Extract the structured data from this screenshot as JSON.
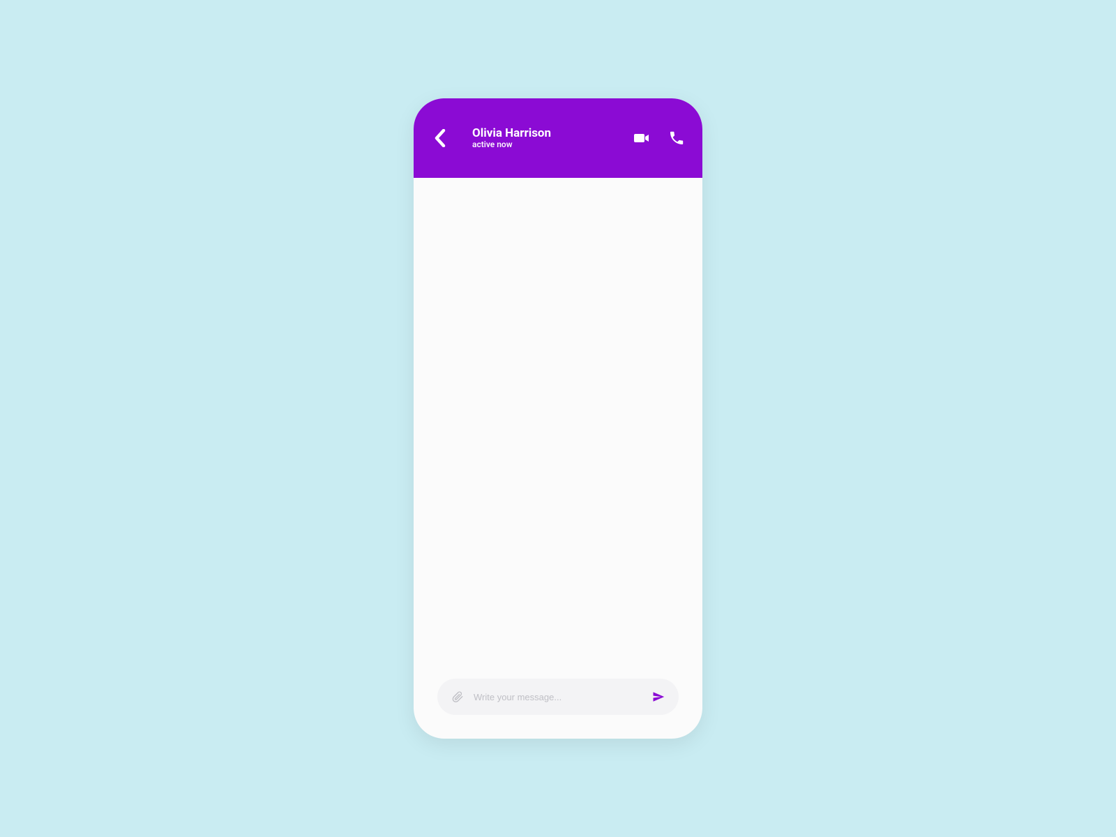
{
  "colors": {
    "background": "#c9ecf2",
    "accent": "#8b0bd4",
    "surface": "#fbfbfb",
    "composer": "#f3f3f5",
    "placeholder": "#bfbfc5"
  },
  "header": {
    "contact_name": "Olivia Harrison",
    "contact_status": "active now",
    "icons": {
      "back": "chevron-left-icon",
      "video": "video-icon",
      "call": "phone-icon"
    }
  },
  "composer": {
    "placeholder": "Write your message...",
    "value": "",
    "icons": {
      "attach": "paperclip-icon",
      "send": "paper-plane-icon"
    }
  }
}
